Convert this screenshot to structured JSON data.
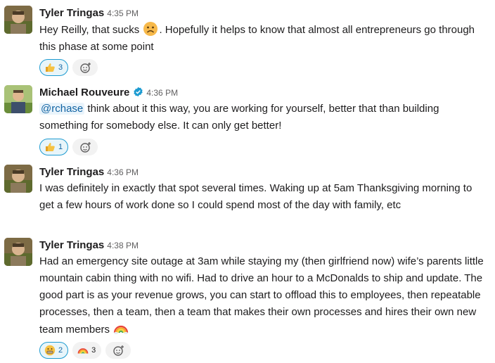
{
  "messages": [
    {
      "author": "Tyler Tringas",
      "time": "4:35 PM",
      "text_a": "Hey Reilly, that sucks ",
      "emoji": "sad-face-emoji",
      "text_b": ". Hopefully it helps to know that almost all entrepreneurs go through this phase at some point",
      "reactions": [
        {
          "emoji": "thumbs-up",
          "count": "3",
          "active": true
        }
      ]
    },
    {
      "author": "Michael Rouveure",
      "verified": true,
      "time": "4:36 PM",
      "mention": "@rchase",
      "text_b": " think about it this way, you are working for yourself, better that than building something for somebody else. It can only get better!",
      "reactions": [
        {
          "emoji": "thumbs-up",
          "count": "1",
          "active": true
        }
      ]
    },
    {
      "author": "Tyler Tringas",
      "time": "4:36 PM",
      "text": "I was definitely in exactly that spot several times. Waking up at 5am Thanksgiving morning to get a few hours of work done so I could spend most of the day with family, etc"
    },
    {
      "author": "Tyler Tringas",
      "time": "4:38 PM",
      "text_a": "Had an emergency site outage at 3am while staying my (then girlfriend now) wife’s parents little mountain cabin thing with no wifi. Had to drive an hour to a McDonalds to ship and update. The good part is as your revenue grows, you can start to offload this to employees, then repeatable processes, then a team, then a team that makes their own processes and hires their own new team members ",
      "emoji": "rainbow-emoji",
      "reactions": [
        {
          "emoji": "grimacing-face",
          "count": "2",
          "active": true
        },
        {
          "emoji": "rainbow",
          "count": "3",
          "active": false
        }
      ]
    }
  ],
  "colors": {
    "text": "#1d1c1d",
    "timestamp": "#616061",
    "mention_text": "#1264a3",
    "mention_bg": "#eaf4fb",
    "reaction_active_border": "#1d9bd1",
    "reaction_active_bg": "#e8f5fa",
    "reaction_bg": "#f2f2f2",
    "verified_badge": "#1d9bd1"
  }
}
